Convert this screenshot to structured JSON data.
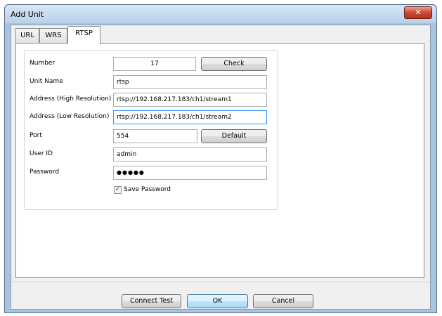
{
  "window": {
    "title": "Add Unit",
    "close_glyph": "✕"
  },
  "tabs": [
    {
      "label": "URL",
      "active": false
    },
    {
      "label": "WRS",
      "active": false
    },
    {
      "label": "RTSP",
      "active": true
    }
  ],
  "form": {
    "number": {
      "label": "Number",
      "value": "17",
      "button": "Check"
    },
    "unit_name": {
      "label": "Unit Name",
      "value": "rtsp"
    },
    "address_high": {
      "label": "Address (High Resolution)",
      "value": "rtsp://192.168.217.183/ch1/stream1"
    },
    "address_low": {
      "label": "Address (Low Resolution)",
      "value": "rtsp://192.168.217.183/ch1/stream2"
    },
    "port": {
      "label": "Port",
      "value": "554",
      "button": "Default"
    },
    "user_id": {
      "label": "User ID",
      "value": "admin"
    },
    "password": {
      "label": "Password",
      "value": "●●●●●"
    },
    "save_password": {
      "label": "Save Password",
      "checked": true,
      "glyph": "✓"
    }
  },
  "buttons": {
    "connect_test": "Connect Test",
    "ok": "OK",
    "cancel": "Cancel"
  }
}
